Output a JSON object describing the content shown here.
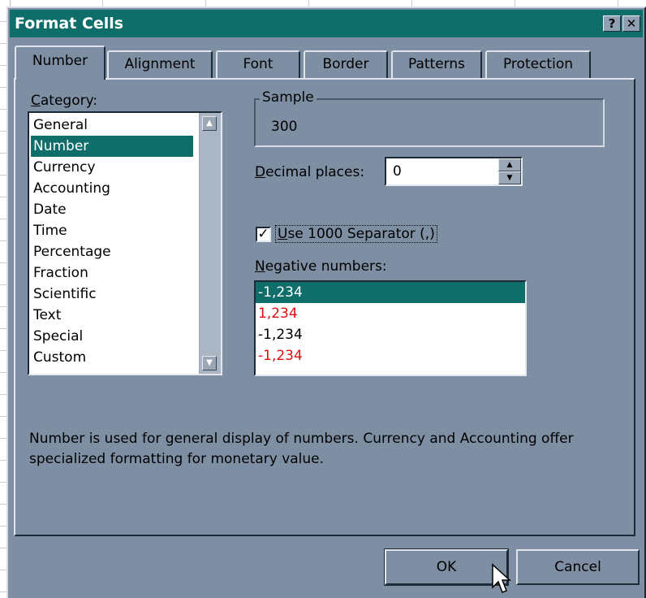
{
  "window": {
    "title": "Format Cells",
    "help_button": "?",
    "close_button": "✕"
  },
  "tabs": [
    {
      "label": "Number",
      "active": true
    },
    {
      "label": "Alignment",
      "active": false
    },
    {
      "label": "Font",
      "active": false
    },
    {
      "label": "Border",
      "active": false
    },
    {
      "label": "Patterns",
      "active": false
    },
    {
      "label": "Protection",
      "active": false
    }
  ],
  "category": {
    "label_first": "C",
    "label_rest": "ategory:",
    "items": [
      "General",
      "Number",
      "Currency",
      "Accounting",
      "Date",
      "Time",
      "Percentage",
      "Fraction",
      "Scientific",
      "Text",
      "Special",
      "Custom"
    ],
    "selected": "Number"
  },
  "sample": {
    "legend": "Sample",
    "value": "300"
  },
  "decimal_places": {
    "label_first": "D",
    "label_rest": "ecimal places:",
    "value": "0"
  },
  "separator": {
    "checked": true,
    "label_first": "U",
    "label_rest": "se 1000 Separator (,)"
  },
  "negative_numbers": {
    "label_first": "N",
    "label_rest": "egative numbers:",
    "items": [
      {
        "text": "-1,234",
        "color": "#ffffff",
        "selected": true
      },
      {
        "text": "1,234",
        "color": "#e01010",
        "selected": false
      },
      {
        "text": "-1,234",
        "color": "#000000",
        "selected": false
      },
      {
        "text": "-1,234",
        "color": "#e01010",
        "selected": false
      }
    ]
  },
  "description": "Number is used for general display of numbers.  Currency and Accounting offer specialized formatting for monetary value.",
  "buttons": {
    "ok": "OK",
    "cancel": "Cancel"
  },
  "colors": {
    "dialog_bg": "#7e8fa3",
    "titlebar": "#0f6d6a",
    "selection": "#0f6d6a",
    "negative_red": "#e01010"
  }
}
